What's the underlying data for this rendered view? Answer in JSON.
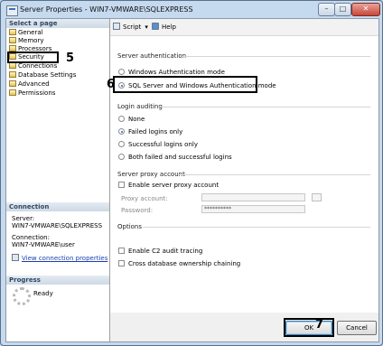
{
  "window": {
    "title": "Server Properties - WIN7-VMWARE\\SQLEXPRESS",
    "min_glyph": "–",
    "max_glyph": "□",
    "close_glyph": "✕"
  },
  "left": {
    "header": "Select a page",
    "pages": [
      "General",
      "Memory",
      "Processors",
      "Security",
      "Connections",
      "Database Settings",
      "Advanced",
      "Permissions"
    ],
    "connection_header": "Connection",
    "server_label": "Server:",
    "server_value": "WIN7-VMWARE\\SQLEXPRESS",
    "connection_label": "Connection:",
    "connection_value": "WIN7-VMWARE\\user",
    "view_link": "View connection properties",
    "progress_header": "Progress",
    "progress_status": "Ready"
  },
  "toolbar": {
    "script_label": "Script",
    "help_label": "Help"
  },
  "auth": {
    "section": "Server authentication",
    "windows_only": "Windows Authentication mode",
    "mixed": "SQL Server and Windows Authentication mode",
    "selected": "mixed"
  },
  "audit": {
    "section": "Login auditing",
    "options": [
      "None",
      "Failed logins only",
      "Successful logins only",
      "Both failed and successful logins"
    ],
    "selected_index": 1
  },
  "proxy": {
    "section": "Server proxy account",
    "enable_label": "Enable server proxy account",
    "enabled": false,
    "account_label": "Proxy account:",
    "account_value": "",
    "password_label": "Password:",
    "password_value": "**********"
  },
  "options": {
    "section": "Options",
    "c2_label": "Enable C2 audit tracing",
    "c2_checked": false,
    "chaining_label": "Cross database ownership chaining",
    "chaining_checked": false
  },
  "buttons": {
    "ok": "OK",
    "cancel": "Cancel"
  },
  "annotations": {
    "security_step": "5",
    "auth_step": "6",
    "ok_step": "7"
  }
}
